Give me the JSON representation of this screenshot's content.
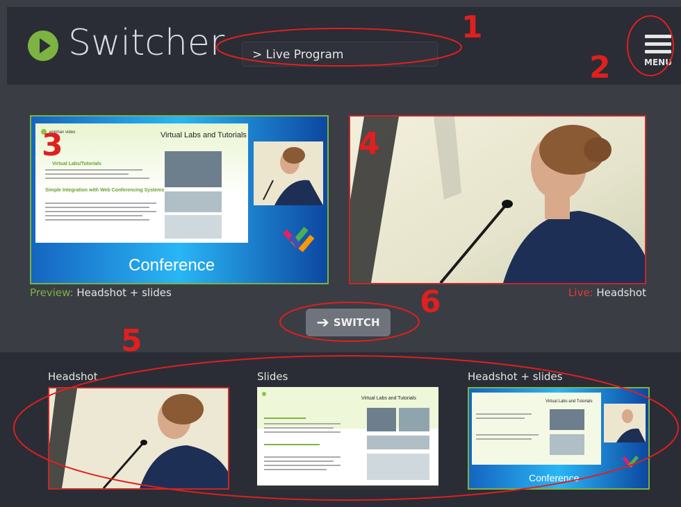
{
  "header": {
    "app_title": "Switcher",
    "program_select": "> Live Program",
    "menu_label": "MENU"
  },
  "preview": {
    "prefix": "Preview:",
    "source": "Headshot + slides"
  },
  "live": {
    "prefix": "Live:",
    "source": "Headshot"
  },
  "switch_button": "SWITCH",
  "sources": [
    {
      "label": "Headshot"
    },
    {
      "label": "Slides"
    },
    {
      "label": "Headshot + slides"
    }
  ],
  "slide": {
    "logo_text": "epiphan video",
    "title": "Virtual Labs and Tutorials",
    "h1": "Virtual Labs/Tutorials",
    "h2": "Simple Integration with Web Conferencing Systems",
    "banner": "Conference"
  },
  "annotations": [
    "1",
    "2",
    "3",
    "4",
    "5",
    "6"
  ],
  "colors": {
    "accent_green": "#7cb342",
    "live_red": "#c62828",
    "annotation_red": "#e01f1f"
  }
}
